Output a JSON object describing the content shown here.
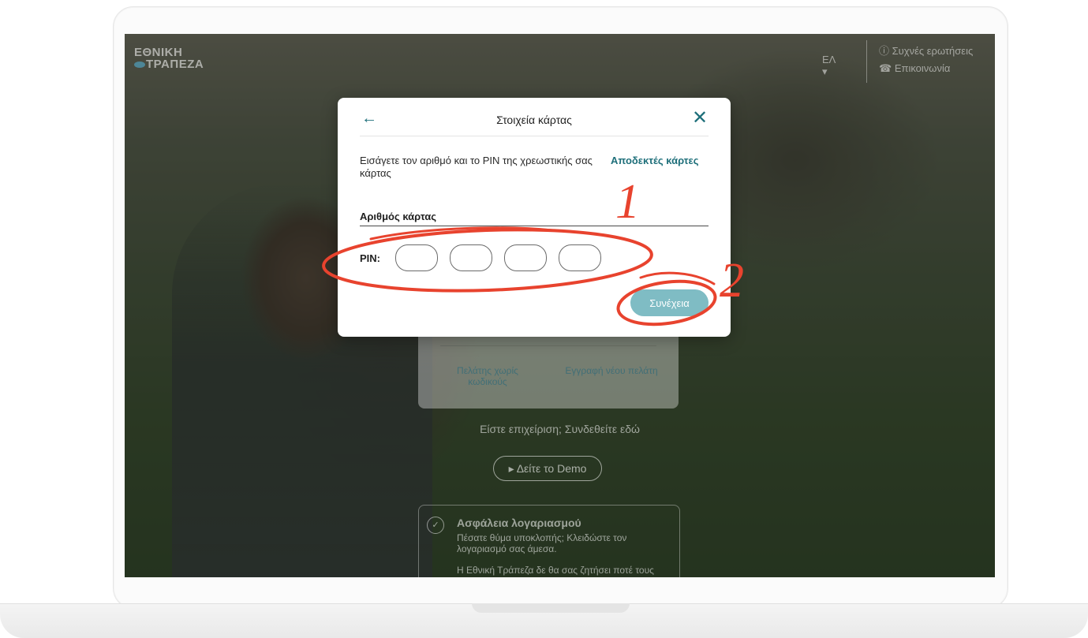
{
  "site": {
    "brand_line1": "ΕΘΝΙΚΗ",
    "brand_line2": "ΤΡΑΠΕΖΑ",
    "language": "ΕΛ ▾",
    "faq": "Συχνές ερωτήσεις",
    "contact": "Επικοινωνία"
  },
  "background": {
    "no_codes_option": "Πελάτης χωρίς κωδικούς",
    "register_option": "Εγγραφή νέου πελάτη",
    "business_text": "Είστε επιχείριση; Συνδεθείτε εδώ",
    "demo_button": "▸  Δείτε το Demo",
    "security_title": "Ασφάλεια λογαριασμού",
    "security_text": "Πέσατε θύμα υποκλοπής; Κλειδώστε τον λογαριασμό σας άμεσα.",
    "security_text2": "Η Εθνική Τράπεζα δε θα σας ζητήσει ποτέ τους"
  },
  "modal": {
    "title": "Στοιχεία κάρτας",
    "back_icon": "←",
    "close_icon": "✕",
    "instructions": "Εισάγετε τον αριθμό και το PIN της χρεωστικής σας κάρτας",
    "accepted_cards_link": "Αποδεκτές κάρτες",
    "card_number_label": "Αριθμός κάρτας",
    "card_number_value": "",
    "pin_label": "PIN:",
    "pin_digits": [
      "",
      "",
      "",
      ""
    ],
    "continue_button": "Συνέχεια"
  },
  "annotations": {
    "mark_1": "1",
    "mark_2": "2",
    "color": "#e8432e"
  }
}
